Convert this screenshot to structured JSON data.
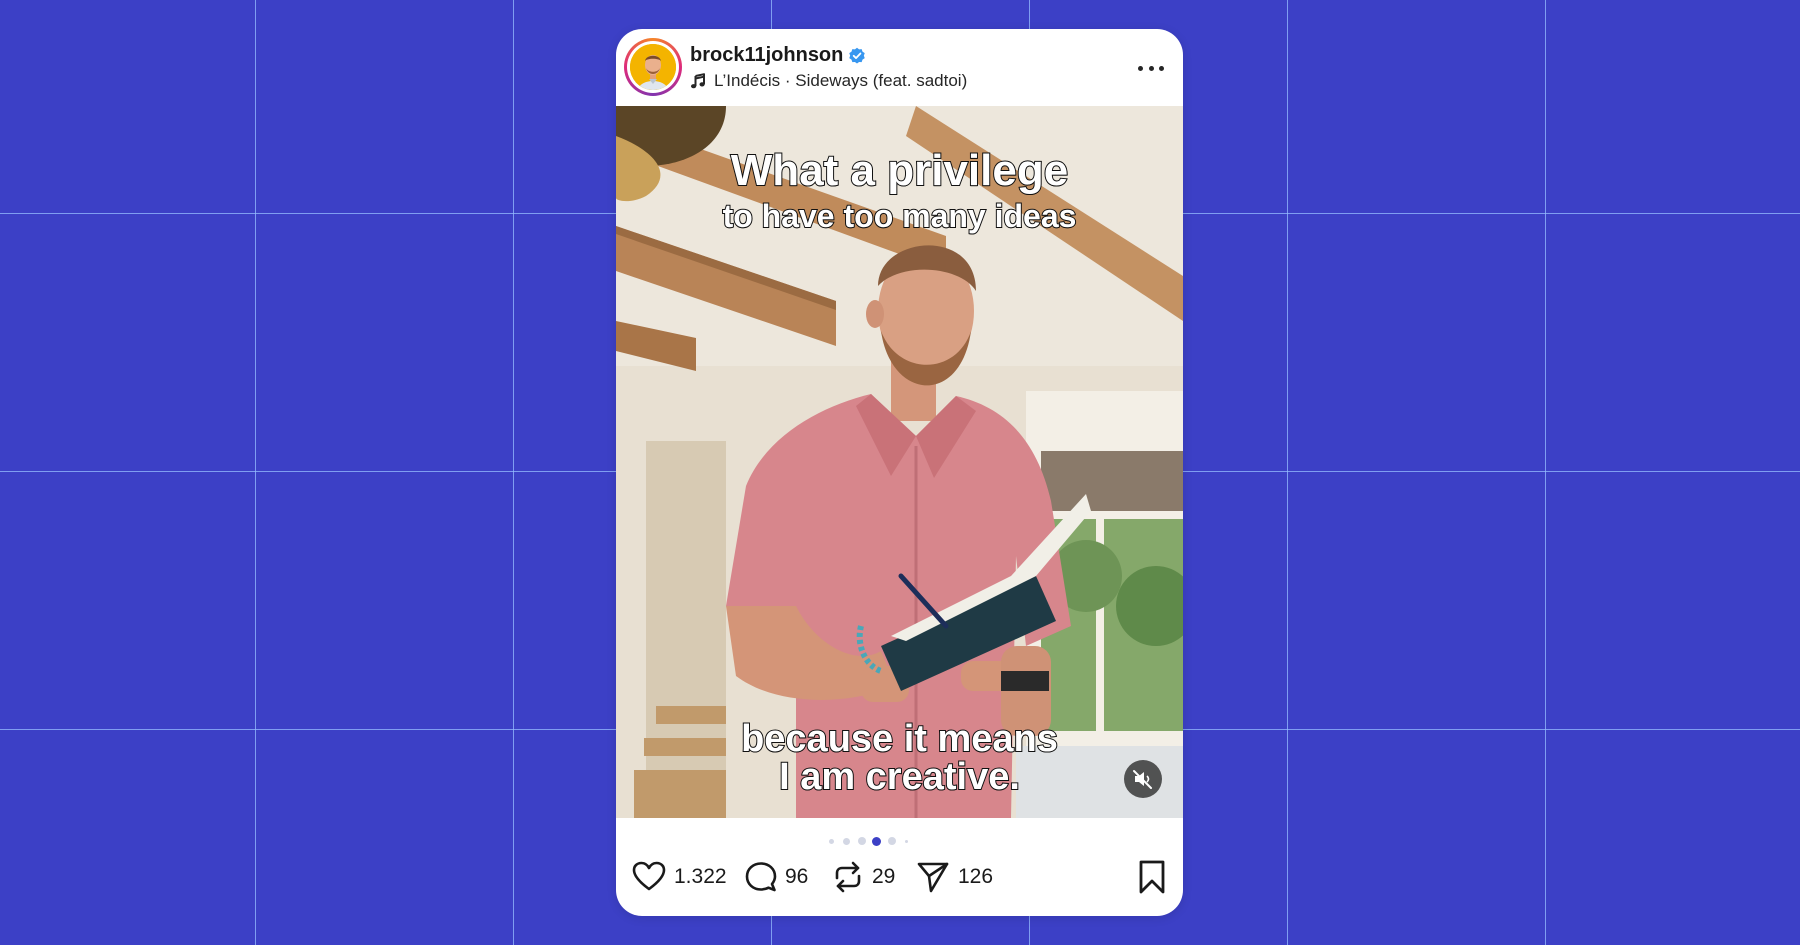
{
  "post": {
    "username": "brock11johnson",
    "song": "L’Indécis · Sideways (feat. sadtoi)"
  },
  "media": {
    "caption_line_1": "What a privilege",
    "caption_line_2": "to have too many ideas",
    "caption_line_3": "because it means",
    "caption_line_4": "I am creative.",
    "carousel_total": 6,
    "carousel_active_index": 4
  },
  "actions": {
    "likes": "1.322",
    "comments": "96",
    "reposts": "29",
    "shares": "126"
  },
  "colors": {
    "background": "#3c40c6",
    "verified": "#3897f0",
    "active_dot": "#3c40c6"
  },
  "icons": [
    "verified-badge-icon",
    "music-note-icon",
    "more-icon",
    "mute-icon",
    "heart-icon",
    "comment-icon",
    "repost-icon",
    "share-icon",
    "bookmark-icon"
  ]
}
